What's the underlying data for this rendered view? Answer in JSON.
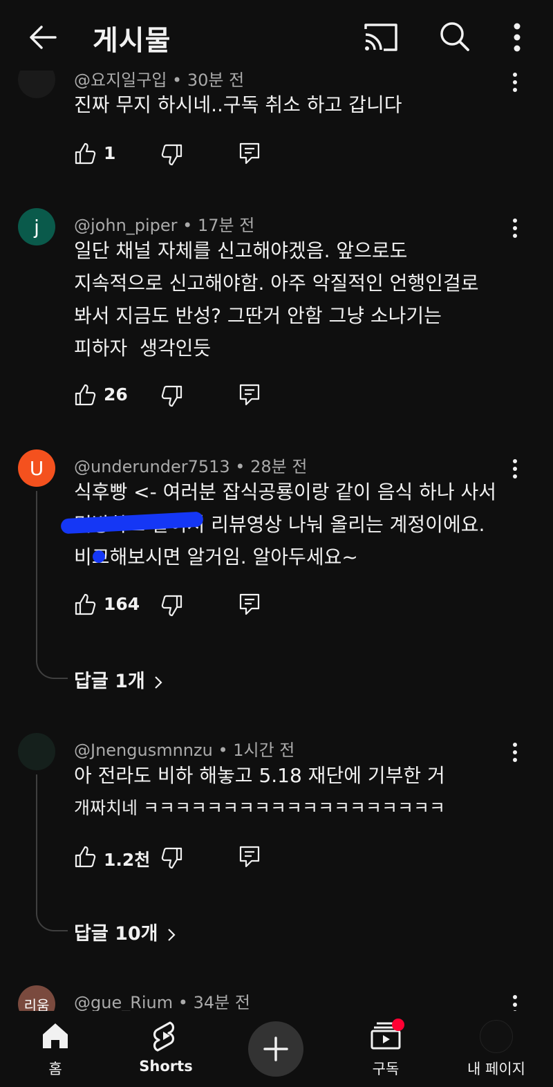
{
  "header": {
    "title": "게시물"
  },
  "comments": [
    {
      "avatar_letter": "",
      "avatar_color": "#1a1a1a",
      "author": "@요지일구입",
      "time": "30분 전",
      "text": [
        "진짜 무지 하시네..구독 취소 하고 갑니다"
      ],
      "likes": "1",
      "replies": ""
    },
    {
      "avatar_letter": "j",
      "avatar_color": "#0a5a4b",
      "author": "@john_piper",
      "time": "17분 전",
      "text": [
        "일단 채널 자체를 신고해야겠음. 앞으로도",
        "지속적으로 신고해야함. 아주 악질적인 언행인걸로",
        "봐서 지금도 반성? 그딴거 안함 그냥 소나기는",
        "피하자  생각인듯"
      ],
      "likes": "26",
      "replies": ""
    },
    {
      "avatar_letter": "U",
      "avatar_color": "#f4511e",
      "author": "@underunder7513",
      "time": "28분 전",
      "text": [
        "식후빵 <- 여러분 잡식공룡이랑 같이 음식 하나 사서",
        "먹방하고 같이서 리뷰영상 나눠 올리는 계정이에요.",
        "비교해보시면 알거임. 알아두세요~"
      ],
      "likes": "164",
      "replies": "답글 1개"
    },
    {
      "avatar_letter": "",
      "avatar_color": "#15201c",
      "author": "@Jnengusmnnzu",
      "time": "1시간 전",
      "text": [
        "아 전라도 비하 해놓고 5.18 재단에 기부한 거",
        "개짜치네 ㅋㅋㅋㅋㅋㅋㅋㅋㅋㅋㅋㅋㅋㅋㅋㅋㅋㅋㅋ"
      ],
      "likes": "1.2천",
      "replies": "답글 10개"
    },
    {
      "avatar_letter": "리움",
      "avatar_color": "#7a4a3e",
      "author": "@gue_Rium",
      "time": "34분 전",
      "text": [],
      "likes": "",
      "replies": ""
    }
  ],
  "nav": {
    "home": "홈",
    "shorts": "Shorts",
    "subscriptions": "구독",
    "me": "내 페이지"
  },
  "icons": [
    "back-arrow-icon",
    "cast-icon",
    "search-icon",
    "more-vert-icon",
    "thumb-up-icon",
    "thumb-down-icon",
    "comment-reply-icon",
    "chevron-right-icon",
    "home-icon",
    "shorts-icon",
    "plus-icon",
    "subscriptions-icon"
  ]
}
